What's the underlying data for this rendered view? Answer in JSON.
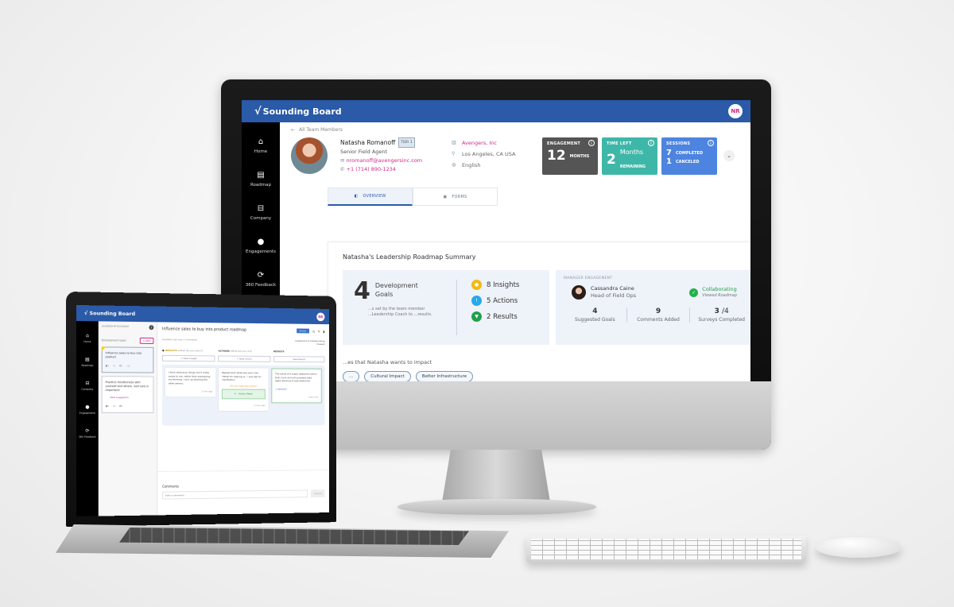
{
  "desktop": {
    "app_name": "Sounding Board",
    "user_initials": "NR",
    "sidebar": [
      {
        "label": "Home",
        "icon": "home-icon",
        "glyph": "⌂"
      },
      {
        "label": "Roadmap",
        "icon": "roadmap-icon",
        "glyph": "▤"
      },
      {
        "label": "Company",
        "icon": "company-icon",
        "glyph": "⊟"
      },
      {
        "label": "Engagements",
        "icon": "person-icon",
        "glyph": "●"
      },
      {
        "label": "360 Feedback",
        "icon": "refresh-icon",
        "glyph": "⟳"
      }
    ],
    "breadcrumb": "All Team Members",
    "profile": {
      "name": "Natasha Romanoff",
      "tier_label": "TIER",
      "tier_value": "1",
      "title": "Senior Field Agent",
      "email": "nromanoff@avengersinc.com",
      "phone": "+1 (714) 890-1234",
      "company": "Avengers, Inc",
      "location": "Los Angeles, CA USA",
      "language": "English"
    },
    "stats": {
      "engagement": {
        "label": "ENGAGEMENT",
        "value": "12",
        "unit": "MONTHS",
        "color": "#555555"
      },
      "time_left": {
        "label": "TIME LEFT",
        "value": "2",
        "unit": "Months",
        "sub": "REMAINING",
        "color": "#3fb7a8"
      },
      "sessions": {
        "label": "SESSIONS",
        "completed": "7",
        "completed_label": "COMPLETED",
        "canceled": "1",
        "canceled_label": "CANCELED",
        "color": "#4d84e0"
      }
    },
    "tabs": [
      {
        "label": "OVERVIEW",
        "active": true
      },
      {
        "label": "FORMS",
        "active": false
      }
    ],
    "summary": {
      "title": "Natasha's Leadership Roadmap Summary",
      "goals_count": "4",
      "goals_label_1": "Development",
      "goals_label_2": "Goals",
      "goals_desc": "...s set by the team member ...Leadership Coach to ...results.",
      "insights": "8 Insights",
      "actions": "5 Actions",
      "results": "2 Results",
      "manager": {
        "header": "MANAGER ENGAGEMENT",
        "name": "Cassandra Caine",
        "title": "Head of Field Ops",
        "status": "Collaborating",
        "status_sub": "Viewed Roadmap",
        "suggested_goals": "4",
        "suggested_goals_label": "Suggested Goals",
        "comments_added": "9",
        "comments_added_label": "Comments Added",
        "surveys_completed": "3",
        "surveys_total": "/4",
        "surveys_label": "Surveys Completed"
      },
      "impact_label": "...es that Natasha wants to impact",
      "impact_chips": [
        "...",
        "Cultural Impact",
        "Better Infrastructure"
      ]
    },
    "colors": {
      "brand": "#2a5aa8",
      "accent_pink": "#d0288b",
      "insight": "#f2b90f",
      "action": "#29a9e8",
      "result": "#22a04b"
    }
  },
  "laptop": {
    "app_name": "Sounding Board",
    "user_initials": "NR",
    "sidebar": [
      {
        "label": "Home",
        "glyph": "⌂"
      },
      {
        "label": "Roadmap",
        "glyph": "▤"
      },
      {
        "label": "Company",
        "glyph": "⊟"
      },
      {
        "label": "Engagement",
        "glyph": "●"
      },
      {
        "label": "360 Feedback",
        "glyph": "⟳"
      }
    ],
    "panel_header": "LEADERSHIP ROADMAP",
    "dev_goals_label": "Development Goals",
    "add_label": "+ ADD",
    "goals": [
      {
        "text": "Influence sales to buy into product",
        "selected": true
      },
      {
        "text": "Practice mindfulness with yourself and others. Self care is important!",
        "selected": false,
        "tag": "New suggestion"
      }
    ],
    "goal_title": "Influence sales to buy into product roadmap",
    "action_button": "Action",
    "updated": "Updated just now",
    "comments_link": "Comments",
    "collab_status": "Cassandra is Collaborating",
    "collab_sub": "Viewed",
    "columns": [
      {
        "title": "INSIGHTS",
        "hint": "(What did you learn?)",
        "new": "+ New Insight"
      },
      {
        "title": "ACTIONS",
        "hint": "(What will you do?)",
        "new": "+ New Action"
      },
      {
        "title": "RESULTS",
        "hint": "",
        "new": "New Result"
      }
    ],
    "cards": {
      "insight": {
        "text": "I think whenever things don't make sense to me, rather than expressing my thinking, I end up blaming the other person.",
        "when": "3 min ago"
      },
      "action": {
        "text": "Repeat back what was said. Use \"What I'm hearing is...\" and ask for clarification.",
        "ask": "Did you take the action?",
        "taken": "Action Taken",
        "when": "1 min ago"
      },
      "result": {
        "text": "The result of a super awesome action that I took and will probably take again because it was awesome.",
        "link": "+ INSIGHT",
        "when": "just now"
      }
    },
    "comments_title": "Comments",
    "comment_placeholder": "Add a comment...",
    "comment_submit": "Submit"
  }
}
